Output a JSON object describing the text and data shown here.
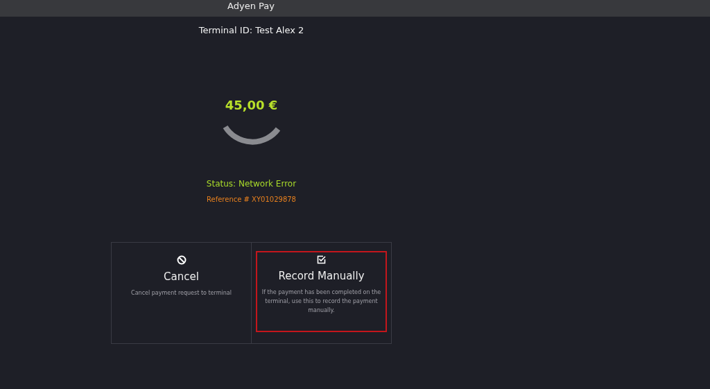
{
  "header": {
    "title": "Adyen Pay"
  },
  "terminal": "Terminal ID: Test Alex 2",
  "amount": "45,00 €",
  "status": "Status: Network Error",
  "reference": "Reference # XY01029878",
  "actions": [
    {
      "kind": "cancel",
      "label": "Cancel",
      "description": "Cancel payment request to terminal",
      "selected": false
    },
    {
      "kind": "record",
      "label": "Record Manually",
      "description": "If the payment has been completed on the terminal, use this to record the payment manually.",
      "selected": true
    }
  ]
}
